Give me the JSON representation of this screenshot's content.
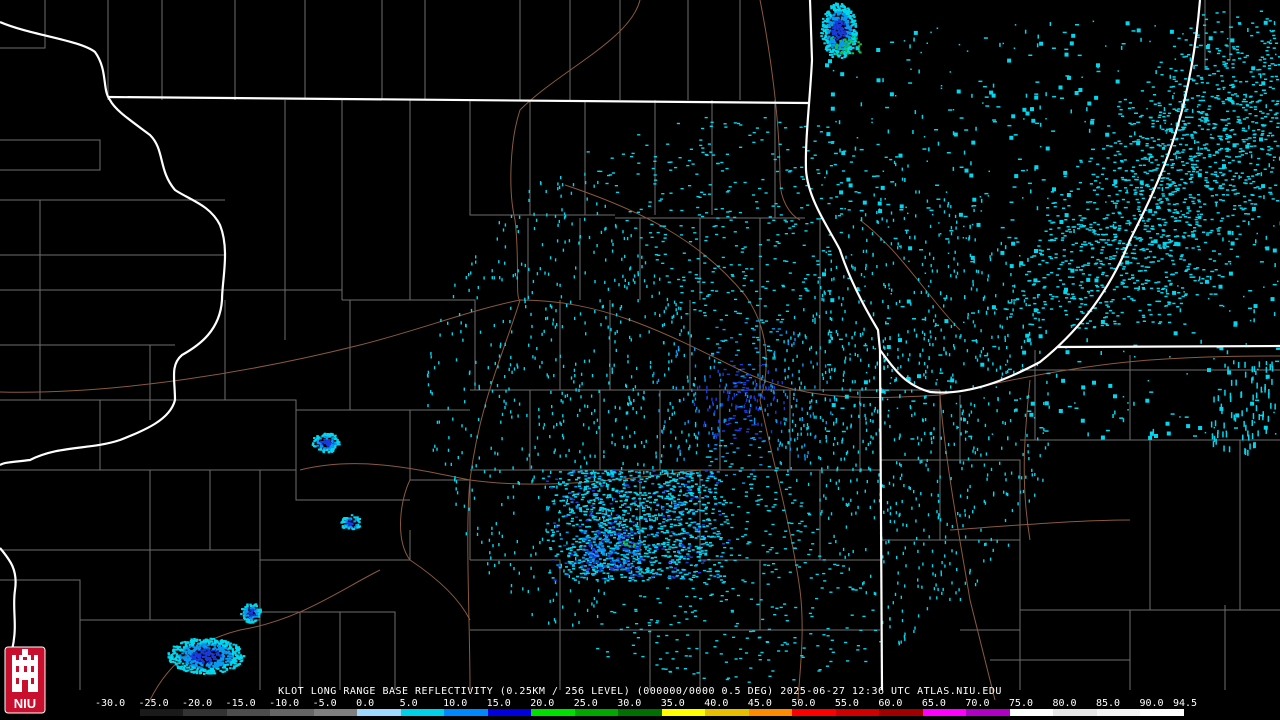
{
  "caption": "KLOT LONG RANGE BASE REFLECTIVITY (0.25KM / 256 LEVEL) (000000/0000 0.5 DEG) 2025-06-27 12:36 UTC  ATLAS.NIU.EDU",
  "logo": {
    "text": "NIU",
    "bg": "#c8102e"
  },
  "scale": {
    "labels": [
      "-30.0",
      "-25.0",
      "-20.0",
      "-15.0",
      "-10.0",
      "-5.0",
      "0.0",
      "5.0",
      "10.0",
      "15.0",
      "20.0",
      "25.0",
      "30.0",
      "35.0",
      "40.0",
      "45.0",
      "50.0",
      "55.0",
      "60.0",
      "65.0",
      "70.0",
      "75.0",
      "80.0",
      "85.0",
      "90.0",
      "94.5"
    ],
    "colors": [
      "#000000",
      "#1a1a1a",
      "#333333",
      "#4d4d4d",
      "#666666",
      "#7f7f7f",
      "#9fd8ff",
      "#00d0e8",
      "#0088ff",
      "#0000e0",
      "#00e000",
      "#00a800",
      "#007000",
      "#ffff00",
      "#e8c000",
      "#ff8c00",
      "#ff0000",
      "#d00000",
      "#a00000",
      "#ff00ff",
      "#b000c8",
      "#ffffff",
      "#e6e6e6",
      "#f4f4f4",
      "#ffffff"
    ]
  },
  "colors": {
    "state_border": "#ffffff",
    "county_line": "#6e6e6e",
    "highway": "#8a5a3c",
    "echo_light": "#00d8ef",
    "echo_mid": "#0a98f0",
    "echo_dark": "#1a3bd8",
    "echo_green": "#18c040"
  }
}
